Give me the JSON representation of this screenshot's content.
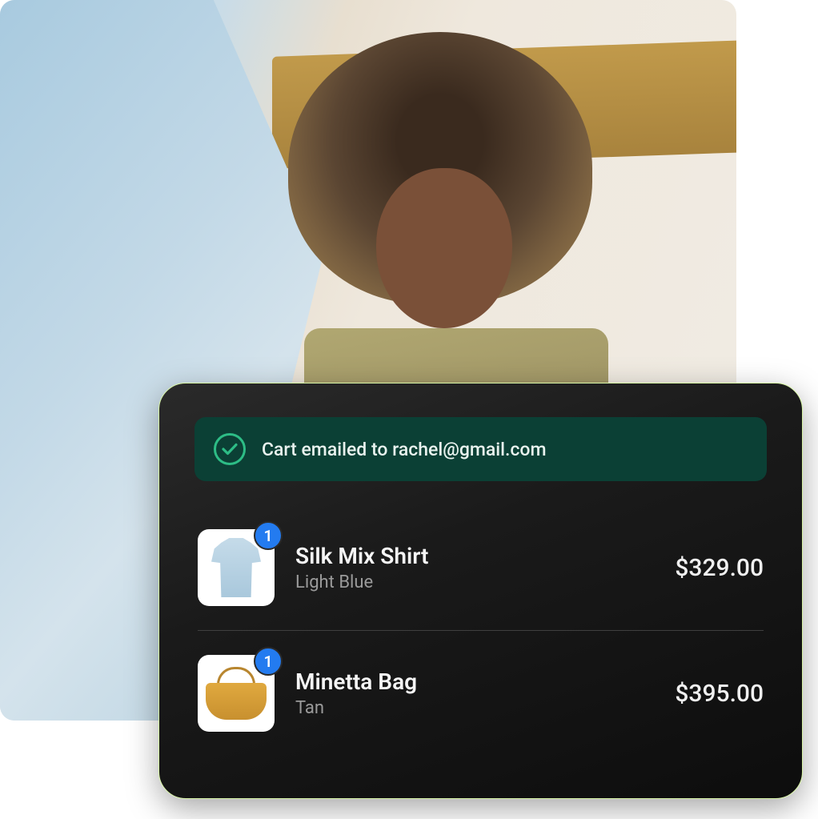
{
  "banner": {
    "message": "Cart emailed to rachel@gmail.com"
  },
  "items": [
    {
      "name": "Silk Mix Shirt",
      "variant": "Light Blue",
      "price": "$329.00",
      "quantity": "1",
      "thumb_kind": "shirt"
    },
    {
      "name": "Minetta Bag",
      "variant": "Tan",
      "price": "$395.00",
      "quantity": "1",
      "thumb_kind": "bag"
    }
  ],
  "colors": {
    "banner_bg": "#0b4035",
    "accent_green": "#2dbd86",
    "badge_blue": "#237bf0",
    "card_bg": "#1a1a1a"
  }
}
